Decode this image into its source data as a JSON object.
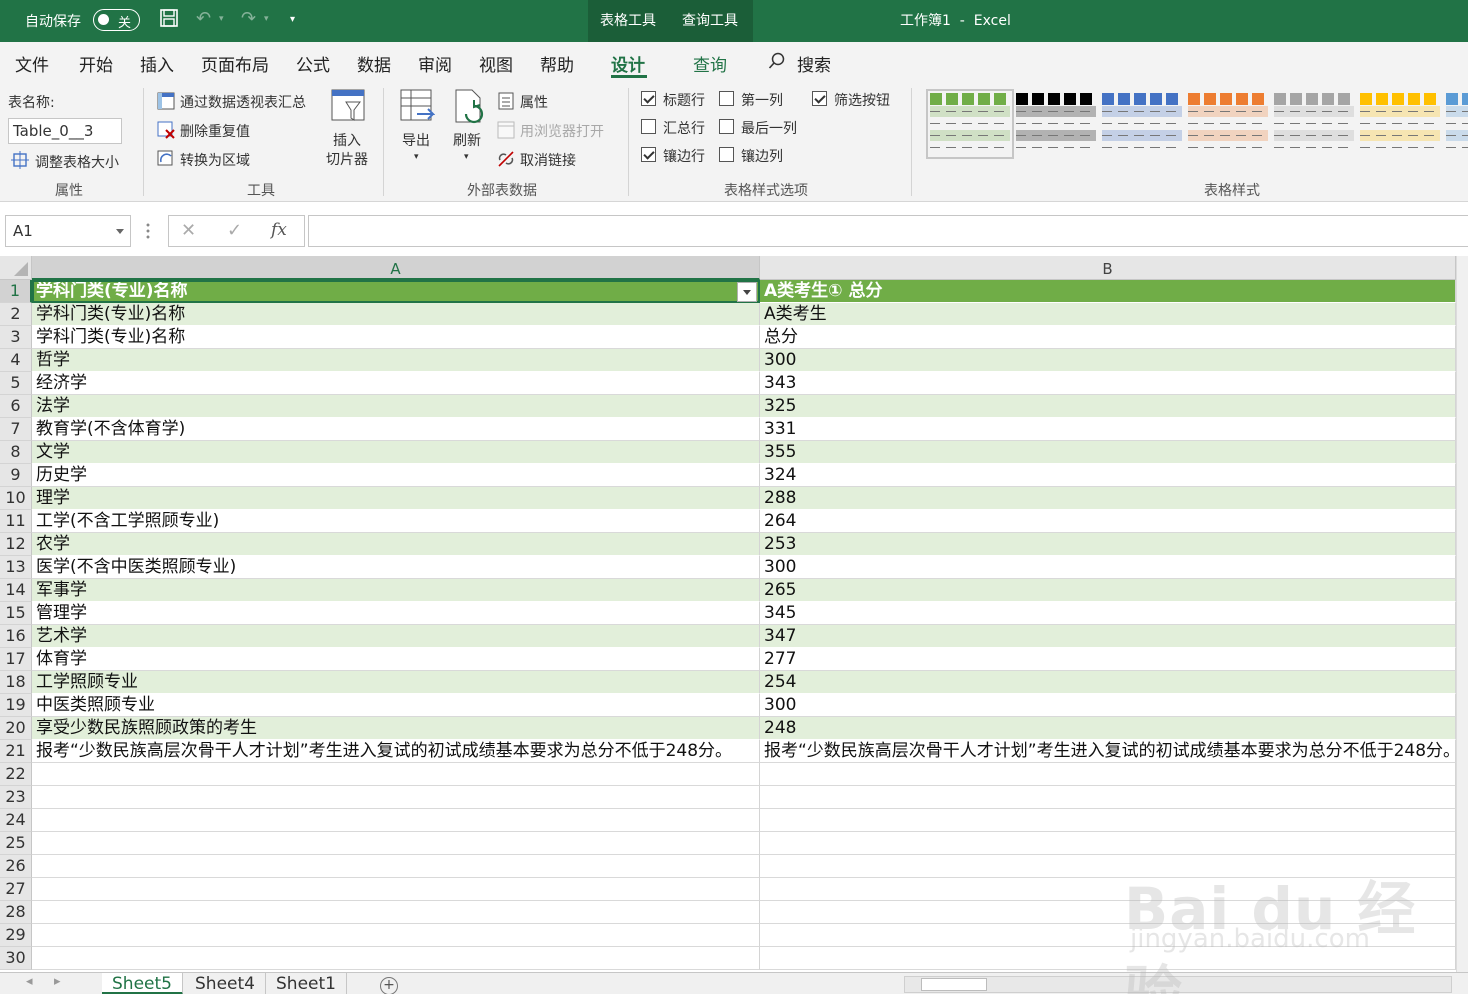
{
  "titlebar": {
    "autosave_label": "自动保存",
    "autosave_state": "关",
    "context_tabs": [
      "表格工具",
      "查询工具"
    ],
    "window_title": "工作簿1  -  Excel",
    "accent_color": "#217346"
  },
  "ribbon_tabs": [
    "文件",
    "开始",
    "插入",
    "页面布局",
    "公式",
    "数据",
    "审阅",
    "视图",
    "帮助",
    "设计",
    "查询"
  ],
  "active_tab": "设计",
  "search": {
    "label": "搜索"
  },
  "ribbon": {
    "properties": {
      "table_name_label": "表名称:",
      "table_name_value": "Table_0__3",
      "resize_label": "调整表格大小",
      "group_label": "属性"
    },
    "tools": {
      "pivot_label": "通过数据透视表汇总",
      "remove_dup_label": "删除重复值",
      "convert_label": "转换为区域",
      "slicer_label_1": "插入",
      "slicer_label_2": "切片器",
      "group_label": "工具"
    },
    "external": {
      "export_label": "导出",
      "refresh_label": "刷新",
      "properties_label": "属性",
      "open_browser_label": "用浏览器打开",
      "unlink_label": "取消链接",
      "group_label": "外部表数据"
    },
    "style_options": {
      "items": [
        {
          "label": "标题行",
          "checked": true
        },
        {
          "label": "汇总行",
          "checked": false
        },
        {
          "label": "镶边行",
          "checked": true
        },
        {
          "label": "第一列",
          "checked": false
        },
        {
          "label": "最后一列",
          "checked": false
        },
        {
          "label": "镶边列",
          "checked": false
        },
        {
          "label": "筛选按钮",
          "checked": true
        }
      ],
      "group_label": "表格样式选项"
    },
    "table_styles": {
      "group_label": "表格样式",
      "swatches": [
        "#70ad47",
        "#000000",
        "#4472c4",
        "#ed7d31",
        "#a5a5a5",
        "#ffc000",
        "#5b9bd5"
      ]
    }
  },
  "formula_bar": {
    "name_box": "A1",
    "cancel_icon": "✕",
    "enter_icon": "✓",
    "fx_label": "fx",
    "formula": ""
  },
  "sheet": {
    "columns": [
      "A",
      "B"
    ],
    "rows": [
      [
        "学科门类(专业)名称",
        "A类考生① 总分"
      ],
      [
        "学科门类(专业)名称",
        "A类考生"
      ],
      [
        "学科门类(专业)名称",
        "总分"
      ],
      [
        "哲学",
        "300"
      ],
      [
        "经济学",
        "343"
      ],
      [
        "法学",
        "325"
      ],
      [
        "教育学(不含体育学)",
        "331"
      ],
      [
        "文学",
        "355"
      ],
      [
        "历史学",
        "324"
      ],
      [
        "理学",
        "288"
      ],
      [
        "工学(不含工学照顾专业)",
        "264"
      ],
      [
        "农学",
        "253"
      ],
      [
        "医学(不含中医类照顾专业)",
        "300"
      ],
      [
        "军事学",
        "265"
      ],
      [
        "管理学",
        "345"
      ],
      [
        "艺术学",
        "347"
      ],
      [
        "体育学",
        "277"
      ],
      [
        "工学照顾专业",
        "254"
      ],
      [
        "中医类照顾专业",
        "300"
      ],
      [
        "享受少数民族照顾政策的考生",
        "248"
      ],
      [
        "报考“少数民族高层次骨干人才计划”考生进入复试的初试成绩基本要求为总分不低于248分。",
        "报考“少数民族高层次骨干人才计划”考生进入复试的初试成绩基本要求为总分不低于248分。"
      ],
      [
        "",
        ""
      ],
      [
        "",
        ""
      ],
      [
        "",
        ""
      ],
      [
        "",
        ""
      ],
      [
        "",
        ""
      ],
      [
        "",
        ""
      ],
      [
        "",
        ""
      ],
      [
        "",
        ""
      ],
      [
        "",
        ""
      ]
    ]
  },
  "sheet_tabs": [
    "Sheet5",
    "Sheet4",
    "Sheet1"
  ],
  "active_sheet": "Sheet5",
  "watermark": {
    "brand": "Bai du 经验",
    "url": "jingyan.baidu.com"
  }
}
